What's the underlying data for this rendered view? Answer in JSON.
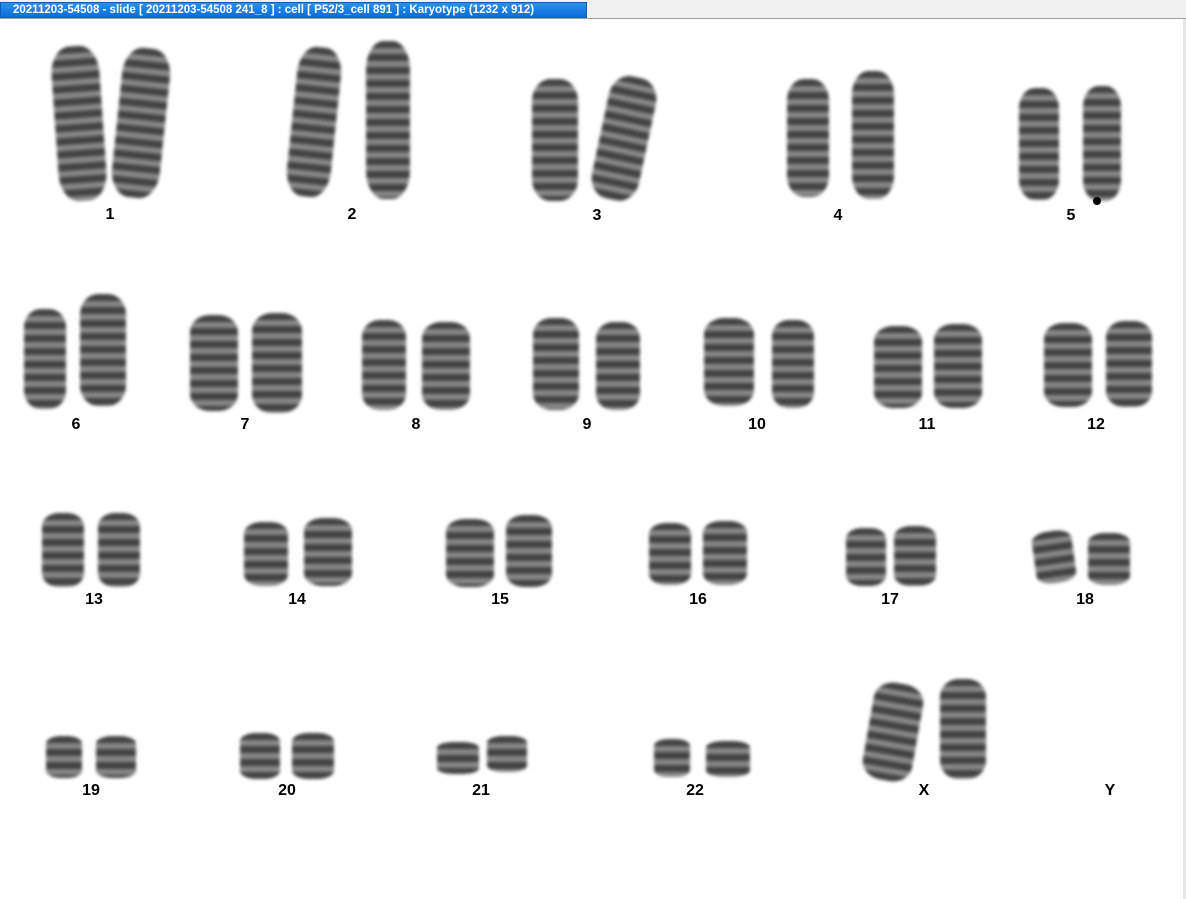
{
  "window": {
    "title": "20211203-54508 - slide [ 20211203-54508 241_8 ] : cell [ P52/3_cell 891 ] : Karyotype  (1232 x 912)"
  },
  "karyotype": {
    "labels": [
      "1",
      "2",
      "3",
      "4",
      "5",
      "6",
      "7",
      "8",
      "9",
      "10",
      "11",
      "12",
      "13",
      "14",
      "15",
      "16",
      "17",
      "18",
      "19",
      "20",
      "21",
      "22",
      "X",
      "Y"
    ]
  }
}
